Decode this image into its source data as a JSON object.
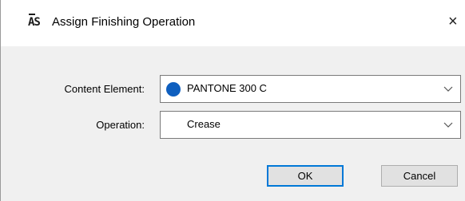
{
  "window": {
    "title": "Assign Finishing Operation",
    "app_icon_text": "AS",
    "close_glyph": "×"
  },
  "form": {
    "content_element": {
      "label": "Content Element:",
      "value": "PANTONE 300 C",
      "swatch_color": "#0f5fbf",
      "icon": "chevron-down-icon"
    },
    "operation": {
      "label": "Operation:",
      "value": "Crease",
      "icon": "chevron-down-icon"
    }
  },
  "buttons": {
    "ok_label": "OK",
    "cancel_label": "Cancel"
  }
}
